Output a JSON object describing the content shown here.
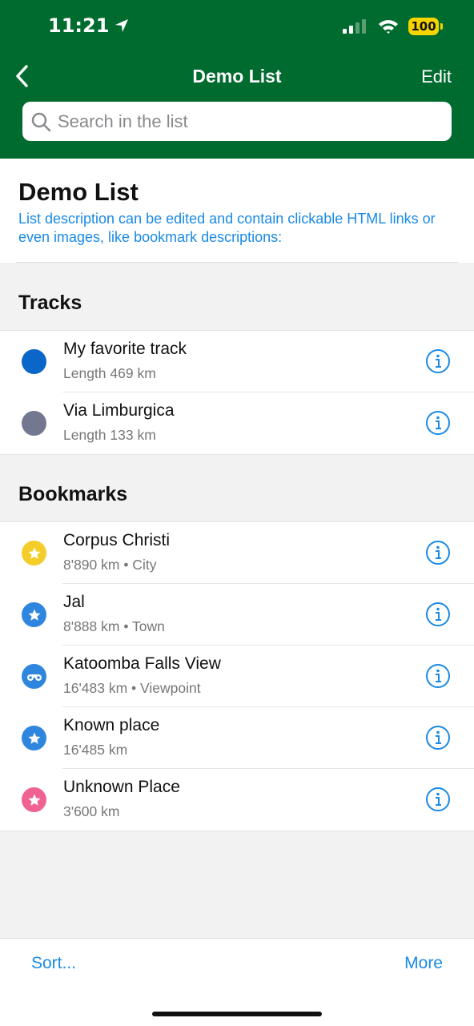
{
  "status": {
    "time": "11:21",
    "battery": "100"
  },
  "nav": {
    "title": "Demo List",
    "edit_label": "Edit"
  },
  "search": {
    "placeholder": "Search in the list"
  },
  "list": {
    "title": "Demo List",
    "description": "List description can be edited and contain clickable HTML links or even images, like bookmark descriptions:"
  },
  "tracks": {
    "header": "Tracks",
    "items": [
      {
        "title": "My favorite track",
        "subtitle": "Length 469 km",
        "color": "#0a66c8"
      },
      {
        "title": "Via Limburgica",
        "subtitle": "Length 133 km",
        "color": "#737890"
      }
    ]
  },
  "bookmarks": {
    "header": "Bookmarks",
    "items": [
      {
        "title": "Corpus Christi",
        "subtitle": "8'890 km • City",
        "color": "#f4cd2a",
        "icon": "star-icon"
      },
      {
        "title": "Jal",
        "subtitle": "8'888 km • Town",
        "color": "#2f86de",
        "icon": "star-icon"
      },
      {
        "title": "Katoomba Falls View",
        "subtitle": "16'483 km • Viewpoint",
        "color": "#2f86de",
        "icon": "binoculars-icon"
      },
      {
        "title": "Known place",
        "subtitle": "16'485 km",
        "color": "#2f86de",
        "icon": "star-icon"
      },
      {
        "title": "Unknown Place",
        "subtitle": "3'600 km",
        "color": "#f06292",
        "icon": "star-icon"
      }
    ]
  },
  "toolbar": {
    "sort_label": "Sort...",
    "more_label": "More"
  },
  "colors": {
    "header_bg": "#006b2e",
    "accent": "#1a8ae6"
  }
}
